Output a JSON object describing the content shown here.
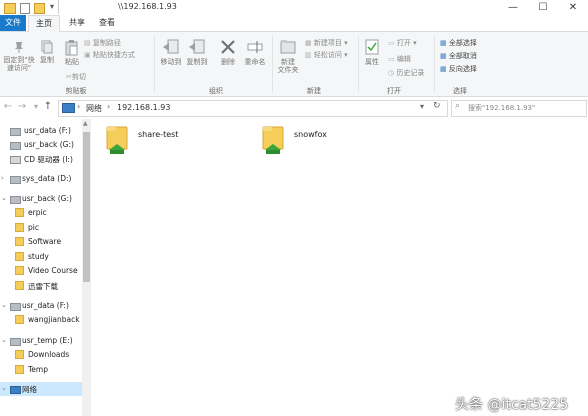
{
  "window": {
    "title": "\\\\192.168.1.93",
    "controls": {
      "minimize": "—",
      "maximize": "☐",
      "close": "✕"
    }
  },
  "tabs": [
    {
      "label": "文件"
    },
    {
      "label": "主页"
    },
    {
      "label": "共享"
    },
    {
      "label": "查看"
    }
  ],
  "ribbon": {
    "clipboard": {
      "pin": "固定到\"快\n速访问\"",
      "copy": "复制",
      "paste": "粘贴",
      "copy_path": "复制路径",
      "paste_shortcut": "粘贴快捷方式",
      "cut": "剪切",
      "group": "剪贴板"
    },
    "organize": {
      "move_to": "移动到",
      "copy_to": "复制到",
      "delete": "删除",
      "rename": "重命名",
      "group": "组织"
    },
    "new": {
      "new_folder": "新建\n文件夹",
      "new_item": "新建项目",
      "easy_access": "轻松访问",
      "group": "新建"
    },
    "open": {
      "properties": "属性",
      "open": "打开",
      "edit": "编辑",
      "history": "历史记录",
      "group": "打开"
    },
    "select": {
      "select_all": "全部选择",
      "select_none": "全部取消",
      "invert": "反向选择",
      "group": "选择"
    }
  },
  "address": {
    "breadcrumb": [
      "网络",
      "192.168.1.93"
    ],
    "search_placeholder": "搜索\"192.168.1.93\""
  },
  "nav": [
    {
      "label": "usr_data (F:)",
      "type": "drive"
    },
    {
      "label": "usr_back (G:)",
      "type": "drive"
    },
    {
      "label": "CD 驱动器 (I:)",
      "type": "drive"
    },
    {
      "label": "sys_data (D:)",
      "type": "drive"
    },
    {
      "label": "usr_back (G:)",
      "type": "drive"
    },
    {
      "label": "erpic",
      "type": "folder"
    },
    {
      "label": "pic",
      "type": "folder"
    },
    {
      "label": "Software",
      "type": "folder"
    },
    {
      "label": "study",
      "type": "folder"
    },
    {
      "label": "Video Course",
      "type": "folder"
    },
    {
      "label": "迅雷下载",
      "type": "folder"
    },
    {
      "label": "usr_data (F:)",
      "type": "drive"
    },
    {
      "label": "wangjianback",
      "type": "folder"
    },
    {
      "label": "usr_temp (E:)",
      "type": "drive"
    },
    {
      "label": "Downloads",
      "type": "folder"
    },
    {
      "label": "Temp",
      "type": "folder"
    },
    {
      "label": "网络",
      "type": "network"
    }
  ],
  "shares": [
    {
      "label": "share-test"
    },
    {
      "label": "snowfox"
    }
  ],
  "watermark": "头条 @itcat5225",
  "colors": {
    "accent": "#1979ca",
    "selection": "#cce8ff",
    "folder": "#f4cd5b",
    "share_arrow": "#3aa63a"
  }
}
